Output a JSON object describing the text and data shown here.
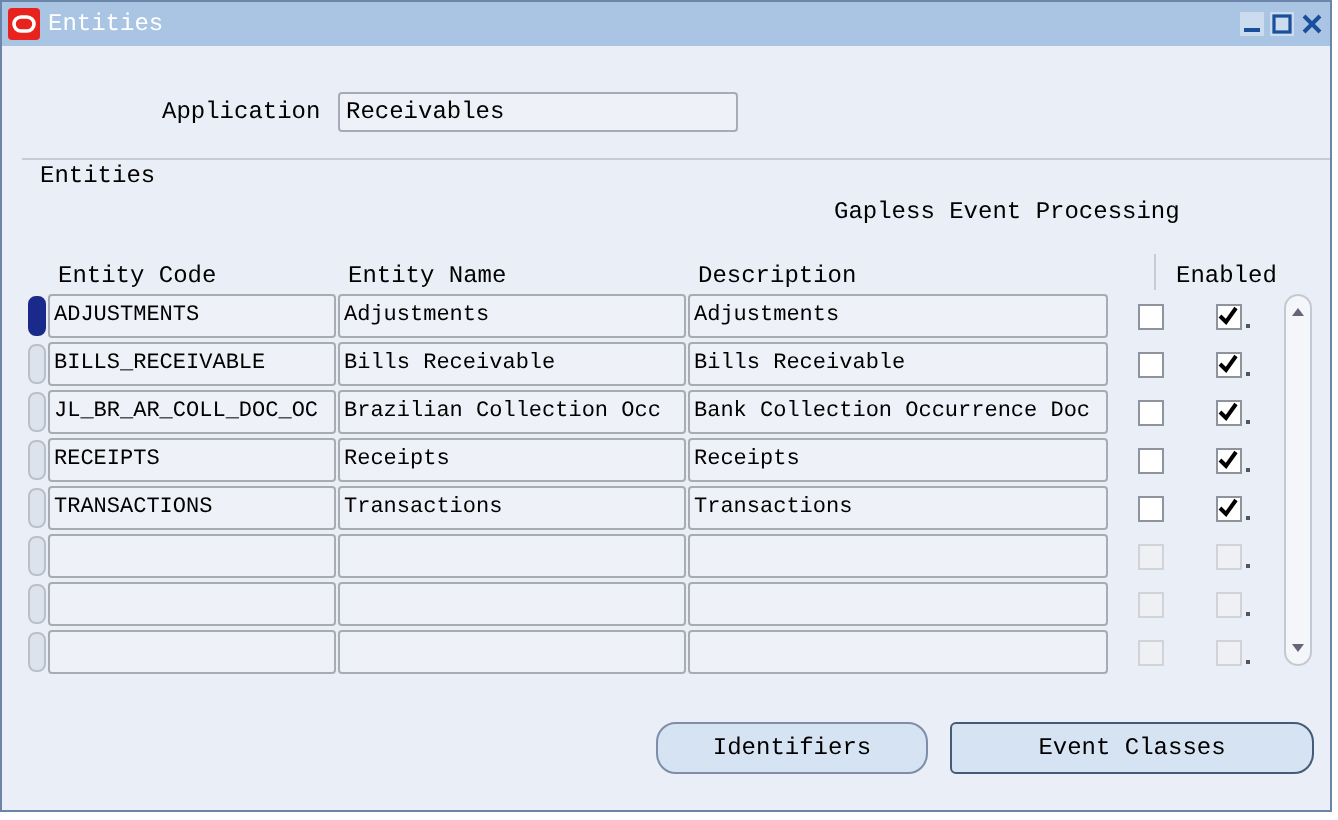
{
  "window": {
    "title": "Entities"
  },
  "application": {
    "label": "Application",
    "value": "Receivables"
  },
  "section": {
    "title": "Entities",
    "group_heading": "Gapless Event Processing"
  },
  "columns": [
    "Entity Code",
    "Entity Name",
    "Description",
    "Enabled"
  ],
  "rows": [
    {
      "code": "ADJUSTMENTS",
      "name": "Adjustments",
      "description": "Adjustments",
      "gapless": false,
      "enabled": true,
      "disabled": false,
      "selected": true
    },
    {
      "code": "BILLS_RECEIVABLE",
      "name": "Bills Receivable",
      "description": "Bills Receivable",
      "gapless": false,
      "enabled": true,
      "disabled": false,
      "selected": false
    },
    {
      "code": "JL_BR_AR_COLL_DOC_OC",
      "name": "Brazilian Collection Occ",
      "description": "Bank Collection Occurrence Doc",
      "gapless": false,
      "enabled": true,
      "disabled": false,
      "selected": false
    },
    {
      "code": "RECEIPTS",
      "name": "Receipts",
      "description": "Receipts",
      "gapless": false,
      "enabled": true,
      "disabled": false,
      "selected": false
    },
    {
      "code": "TRANSACTIONS",
      "name": "Transactions",
      "description": "Transactions",
      "gapless": false,
      "enabled": true,
      "disabled": false,
      "selected": false
    },
    {
      "gapless": false,
      "enabled": false,
      "disabled": true,
      "selected": false
    },
    {
      "gapless": false,
      "enabled": false,
      "disabled": true,
      "selected": false
    },
    {
      "gapless": false,
      "enabled": false,
      "disabled": true,
      "selected": false
    }
  ],
  "buttons": [
    "Identifiers",
    "Event Classes"
  ]
}
